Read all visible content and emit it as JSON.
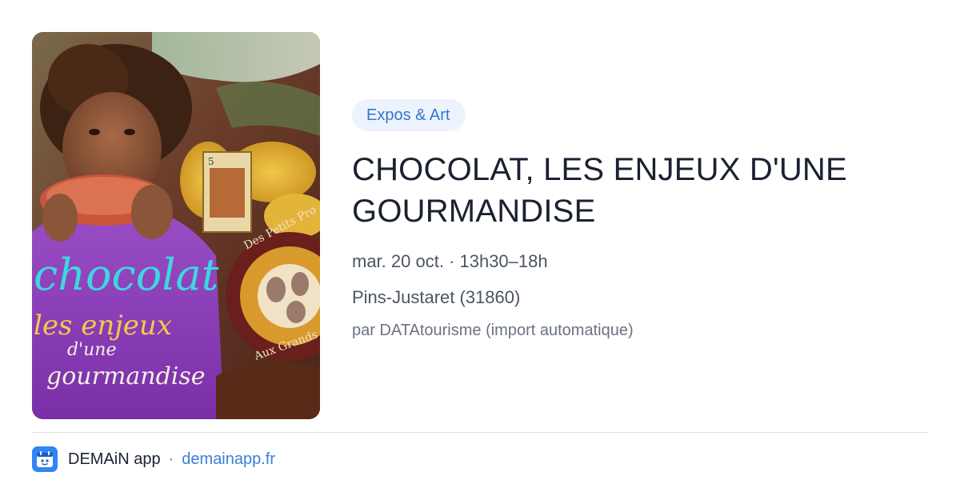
{
  "event": {
    "category": "Expos & Art",
    "title": "CHOCOLAT, LES ENJEUX D'UNE GOURMANDISE",
    "date_time": "mar. 20 oct. · 13h30–18h",
    "location": "Pins-Justaret (31860)",
    "source": "par DATAtourisme (import automatique)"
  },
  "poster": {
    "line1": "chocolat",
    "line2": "les enjeux",
    "line3": "d'une",
    "line4": "gourmandise",
    "seal_text_top": "Des Petits Pro",
    "seal_text_bottom": "Aux Grands A",
    "stamp_value": "5"
  },
  "footer": {
    "app_name": "DEMAiN app",
    "separator": "·",
    "domain": "demainapp.fr"
  },
  "colors": {
    "accent": "#3377cc",
    "pill_bg": "#ecf3fd",
    "logo_bg": "#2f86f4",
    "title": "#1a2130",
    "muted": "#4b5563"
  }
}
